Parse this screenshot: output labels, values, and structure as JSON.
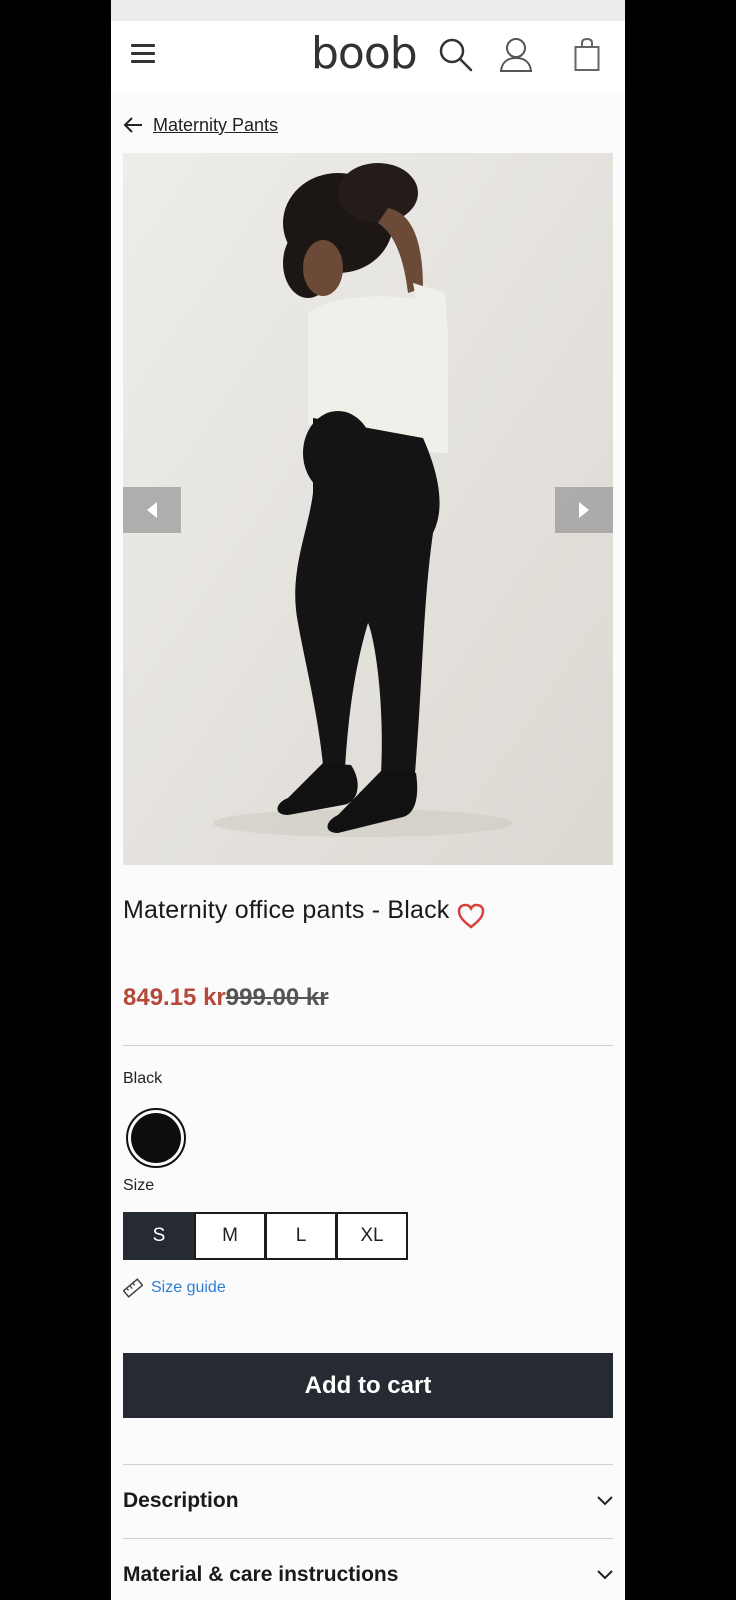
{
  "header": {
    "logo": "boob",
    "icons": [
      "menu-icon",
      "search-icon",
      "account-icon",
      "shopping-bag-icon"
    ]
  },
  "breadcrumb": {
    "label": "Maternity Pants"
  },
  "gallery": {
    "prev_icon": "chevron-left-icon",
    "next_icon": "chevron-right-icon"
  },
  "product": {
    "title": "Maternity office pants - Black",
    "sale_price": "849.15 kr",
    "original_price": "999.00 kr",
    "color_label": "Black",
    "size_label": "Size",
    "sizes": [
      "S",
      "M",
      "L",
      "XL"
    ],
    "selected_size": "S",
    "size_guide": "Size guide",
    "add_to_cart": "Add to cart"
  },
  "accordion": [
    {
      "label": "Description"
    },
    {
      "label": "Material & care instructions"
    }
  ],
  "colors": {
    "sale": "#b54a3a",
    "button": "#262b33",
    "link": "#2d7dd2",
    "heart": "#d8413a"
  }
}
